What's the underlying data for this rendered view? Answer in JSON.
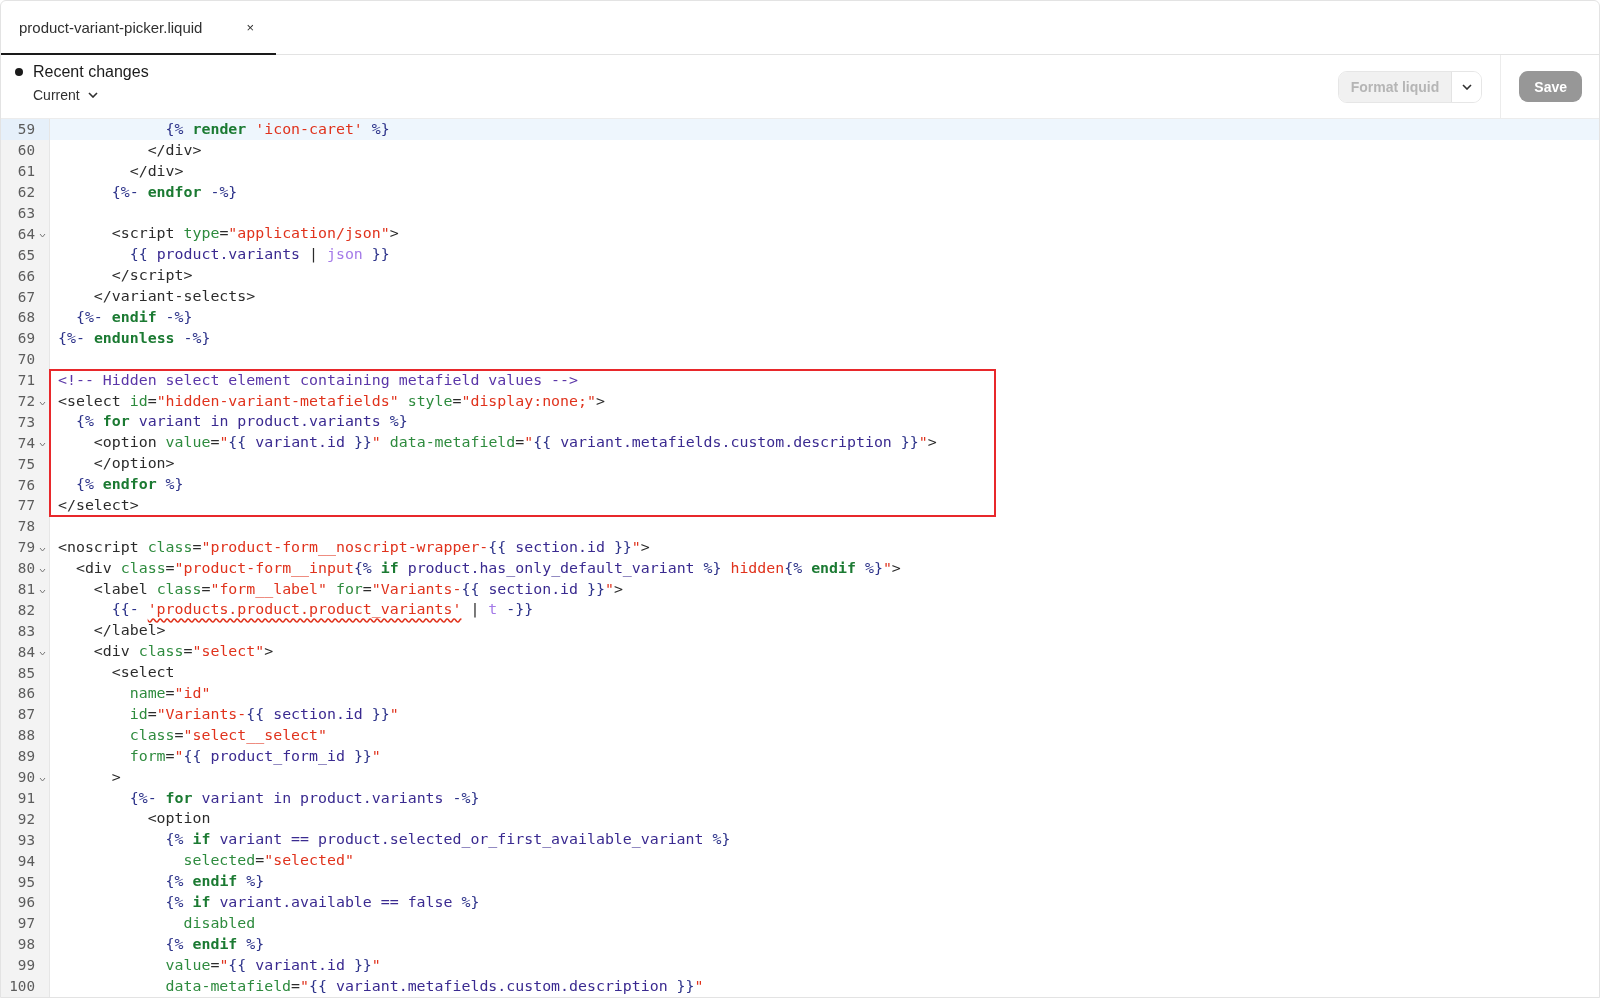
{
  "tab": {
    "title": "product-variant-picker.liquid",
    "close": "×",
    "selected": true
  },
  "toolbar": {
    "status": "Recent changes",
    "version": "Current",
    "format_button": {
      "label": "Format liquid",
      "disabled": true
    },
    "save_button": {
      "label": "Save",
      "disabled": true
    }
  },
  "code": {
    "segments": [
      {
        "highlighted": false,
        "lines": [
          {
            "number": "59",
            "fold": false,
            "active": true,
            "tokens": [
              {
                "kind": "delim",
                "text": "            {% "
              },
              {
                "kind": "keyword",
                "text": "render "
              },
              {
                "kind": "string",
                "text": "'icon-caret' "
              },
              {
                "kind": "delim",
                "text": "%}"
              }
            ]
          },
          {
            "number": "60",
            "fold": false,
            "active": false,
            "tokens": [
              {
                "kind": "tag",
                "text": "          </div>"
              }
            ]
          },
          {
            "number": "61",
            "fold": false,
            "active": false,
            "tokens": [
              {
                "kind": "tag",
                "text": "        </div>"
              }
            ]
          },
          {
            "number": "62",
            "fold": false,
            "active": false,
            "tokens": [
              {
                "kind": "delim",
                "text": "      {%- "
              },
              {
                "kind": "keyword",
                "text": "endfor "
              },
              {
                "kind": "delim",
                "text": "-%}"
              }
            ]
          },
          {
            "number": "63",
            "fold": false,
            "active": false
          },
          {
            "number": "64",
            "fold": true,
            "active": false,
            "tokens": [
              {
                "kind": "tag",
                "text": "      <script "
              },
              {
                "kind": "attr",
                "text": "type"
              },
              {
                "kind": "tag",
                "text": "="
              },
              {
                "kind": "string",
                "text": "\"application/json\""
              },
              {
                "kind": "tag",
                "text": ">"
              }
            ]
          },
          {
            "number": "65",
            "fold": false,
            "active": false,
            "tokens": [
              {
                "kind": "delim",
                "text": "        {{ "
              },
              {
                "kind": "var",
                "text": "product.variants "
              },
              {
                "kind": "tag",
                "text": "| "
              },
              {
                "kind": "filter",
                "text": "json "
              },
              {
                "kind": "delim",
                "text": "}}"
              }
            ]
          },
          {
            "number": "66",
            "fold": false,
            "active": false,
            "tokens": [
              {
                "kind": "tag",
                "text": "      </script>"
              }
            ]
          },
          {
            "number": "67",
            "fold": false,
            "active": false,
            "tokens": [
              {
                "kind": "tag",
                "text": "    </variant-selects>"
              }
            ]
          },
          {
            "number": "68",
            "fold": false,
            "active": false,
            "tokens": [
              {
                "kind": "delim",
                "text": "  {%- "
              },
              {
                "kind": "keyword",
                "text": "endif "
              },
              {
                "kind": "delim",
                "text": "-%}"
              }
            ]
          },
          {
            "number": "69",
            "fold": false,
            "active": false,
            "tokens": [
              {
                "kind": "delim",
                "text": "{%- "
              },
              {
                "kind": "keyword",
                "text": "endunless "
              },
              {
                "kind": "delim",
                "text": "-%}"
              }
            ]
          },
          {
            "number": "70",
            "fold": false,
            "active": false
          }
        ]
      },
      {
        "highlighted": true,
        "lines": [
          {
            "number": "71",
            "fold": false,
            "active": false,
            "tokens": [
              {
                "kind": "comment",
                "text": "<!-- Hidden select element containing metafield values -->"
              }
            ]
          },
          {
            "number": "72",
            "fold": true,
            "active": false,
            "tokens": [
              {
                "kind": "tag",
                "text": "<select "
              },
              {
                "kind": "attr",
                "text": "id"
              },
              {
                "kind": "tag",
                "text": "="
              },
              {
                "kind": "string",
                "text": "\"hidden-variant-metafields\" "
              },
              {
                "kind": "attr",
                "text": "style"
              },
              {
                "kind": "tag",
                "text": "="
              },
              {
                "kind": "string",
                "text": "\"display:none;\""
              },
              {
                "kind": "tag",
                "text": ">"
              }
            ]
          },
          {
            "number": "73",
            "fold": false,
            "active": false,
            "tokens": [
              {
                "kind": "delim",
                "text": "  {% "
              },
              {
                "kind": "keyword",
                "text": "for "
              },
              {
                "kind": "var",
                "text": "variant in product.variants "
              },
              {
                "kind": "delim",
                "text": "%}"
              }
            ]
          },
          {
            "number": "74",
            "fold": true,
            "active": false,
            "tokens": [
              {
                "kind": "tag",
                "text": "    <option "
              },
              {
                "kind": "attr",
                "text": "value"
              },
              {
                "kind": "tag",
                "text": "="
              },
              {
                "kind": "string",
                "text": "\""
              },
              {
                "kind": "delim",
                "text": "{{ "
              },
              {
                "kind": "var",
                "text": "variant.id "
              },
              {
                "kind": "delim",
                "text": "}}"
              },
              {
                "kind": "string",
                "text": "\" "
              },
              {
                "kind": "attr",
                "text": "data-metafield"
              },
              {
                "kind": "tag",
                "text": "="
              },
              {
                "kind": "string",
                "text": "\""
              },
              {
                "kind": "delim",
                "text": "{{ "
              },
              {
                "kind": "var",
                "text": "variant.metafields.custom.description "
              },
              {
                "kind": "delim",
                "text": "}}"
              },
              {
                "kind": "string",
                "text": "\""
              },
              {
                "kind": "tag",
                "text": ">"
              }
            ]
          },
          {
            "number": "75",
            "fold": false,
            "active": false,
            "tokens": [
              {
                "kind": "tag",
                "text": "    </option>"
              }
            ]
          },
          {
            "number": "76",
            "fold": false,
            "active": false,
            "tokens": [
              {
                "kind": "delim",
                "text": "  {% "
              },
              {
                "kind": "keyword",
                "text": "endfor "
              },
              {
                "kind": "delim",
                "text": "%}"
              }
            ]
          },
          {
            "number": "77",
            "fold": false,
            "active": false,
            "tokens": [
              {
                "kind": "tag",
                "text": "</select>"
              }
            ]
          }
        ]
      },
      {
        "highlighted": false,
        "lines": [
          {
            "number": "78",
            "fold": false,
            "active": false
          },
          {
            "number": "79",
            "fold": true,
            "active": false,
            "tokens": [
              {
                "kind": "tag",
                "text": "<noscript "
              },
              {
                "kind": "attr",
                "text": "class"
              },
              {
                "kind": "tag",
                "text": "="
              },
              {
                "kind": "string",
                "text": "\"product-form__noscript-wrapper-"
              },
              {
                "kind": "delim",
                "text": "{{ "
              },
              {
                "kind": "var",
                "text": "section.id "
              },
              {
                "kind": "delim",
                "text": "}}"
              },
              {
                "kind": "string",
                "text": "\""
              },
              {
                "kind": "tag",
                "text": ">"
              }
            ]
          },
          {
            "number": "80",
            "fold": true,
            "active": false,
            "tokens": [
              {
                "kind": "tag",
                "text": "  <div "
              },
              {
                "kind": "attr",
                "text": "class"
              },
              {
                "kind": "tag",
                "text": "="
              },
              {
                "kind": "string",
                "text": "\"product-form__input"
              },
              {
                "kind": "delim",
                "text": "{% "
              },
              {
                "kind": "keyword",
                "text": "if "
              },
              {
                "kind": "var",
                "text": "product.has_only_default_variant "
              },
              {
                "kind": "delim",
                "text": "%}"
              },
              {
                "kind": "string",
                "text": " hidden"
              },
              {
                "kind": "delim",
                "text": "{% "
              },
              {
                "kind": "keyword",
                "text": "endif "
              },
              {
                "kind": "delim",
                "text": "%}"
              },
              {
                "kind": "string",
                "text": "\""
              },
              {
                "kind": "tag",
                "text": ">"
              }
            ]
          },
          {
            "number": "81",
            "fold": true,
            "active": false,
            "tokens": [
              {
                "kind": "tag",
                "text": "    <label "
              },
              {
                "kind": "attr",
                "text": "class"
              },
              {
                "kind": "tag",
                "text": "="
              },
              {
                "kind": "string",
                "text": "\"form__label\" "
              },
              {
                "kind": "attr",
                "text": "for"
              },
              {
                "kind": "tag",
                "text": "="
              },
              {
                "kind": "string",
                "text": "\"Variants-"
              },
              {
                "kind": "delim",
                "text": "{{ "
              },
              {
                "kind": "var",
                "text": "section.id "
              },
              {
                "kind": "delim",
                "text": "}}"
              },
              {
                "kind": "string",
                "text": "\""
              },
              {
                "kind": "tag",
                "text": ">"
              }
            ]
          },
          {
            "number": "82",
            "fold": false,
            "active": false,
            "tokens": [
              {
                "kind": "delim",
                "text": "      {{- "
              },
              {
                "kind": "flagged",
                "text": "'products.product.product_variants'"
              },
              {
                "kind": "tag",
                "text": " | "
              },
              {
                "kind": "filter",
                "text": "t "
              },
              {
                "kind": "delim",
                "text": "-}}"
              }
            ]
          },
          {
            "number": "83",
            "fold": false,
            "active": false,
            "tokens": [
              {
                "kind": "tag",
                "text": "    </label>"
              }
            ]
          },
          {
            "number": "84",
            "fold": true,
            "active": false,
            "tokens": [
              {
                "kind": "tag",
                "text": "    <div "
              },
              {
                "kind": "attr",
                "text": "class"
              },
              {
                "kind": "tag",
                "text": "="
              },
              {
                "kind": "string",
                "text": "\"select\""
              },
              {
                "kind": "tag",
                "text": ">"
              }
            ]
          },
          {
            "number": "85",
            "fold": false,
            "active": false,
            "tokens": [
              {
                "kind": "tag",
                "text": "      <select"
              }
            ]
          },
          {
            "number": "86",
            "fold": false,
            "active": false,
            "tokens": [
              {
                "kind": "attr",
                "text": "        name"
              },
              {
                "kind": "tag",
                "text": "="
              },
              {
                "kind": "string",
                "text": "\"id\""
              }
            ]
          },
          {
            "number": "87",
            "fold": false,
            "active": false,
            "tokens": [
              {
                "kind": "attr",
                "text": "        id"
              },
              {
                "kind": "tag",
                "text": "="
              },
              {
                "kind": "string",
                "text": "\"Variants-"
              },
              {
                "kind": "delim",
                "text": "{{ "
              },
              {
                "kind": "var",
                "text": "section.id "
              },
              {
                "kind": "delim",
                "text": "}}"
              },
              {
                "kind": "string",
                "text": "\""
              }
            ]
          },
          {
            "number": "88",
            "fold": false,
            "active": false,
            "tokens": [
              {
                "kind": "attr",
                "text": "        class"
              },
              {
                "kind": "tag",
                "text": "="
              },
              {
                "kind": "string",
                "text": "\"select__select\""
              }
            ]
          },
          {
            "number": "89",
            "fold": false,
            "active": false,
            "tokens": [
              {
                "kind": "attr",
                "text": "        form"
              },
              {
                "kind": "tag",
                "text": "="
              },
              {
                "kind": "string",
                "text": "\""
              },
              {
                "kind": "delim",
                "text": "{{ "
              },
              {
                "kind": "var",
                "text": "product_form_id "
              },
              {
                "kind": "delim",
                "text": "}}"
              },
              {
                "kind": "string",
                "text": "\""
              }
            ]
          },
          {
            "number": "90",
            "fold": true,
            "active": false,
            "tokens": [
              {
                "kind": "tag",
                "text": "      >"
              }
            ]
          },
          {
            "number": "91",
            "fold": false,
            "active": false,
            "tokens": [
              {
                "kind": "delim",
                "text": "        {%- "
              },
              {
                "kind": "keyword",
                "text": "for "
              },
              {
                "kind": "var",
                "text": "variant in product.variants "
              },
              {
                "kind": "delim",
                "text": "-%}"
              }
            ]
          },
          {
            "number": "92",
            "fold": false,
            "active": false,
            "tokens": [
              {
                "kind": "tag",
                "text": "          <option"
              }
            ]
          },
          {
            "number": "93",
            "fold": false,
            "active": false,
            "tokens": [
              {
                "kind": "delim",
                "text": "            {% "
              },
              {
                "kind": "keyword",
                "text": "if "
              },
              {
                "kind": "var",
                "text": "variant == product.selected_or_first_available_variant "
              },
              {
                "kind": "delim",
                "text": "%}"
              }
            ]
          },
          {
            "number": "94",
            "fold": false,
            "active": false,
            "tokens": [
              {
                "kind": "attr",
                "text": "              selected"
              },
              {
                "kind": "tag",
                "text": "="
              },
              {
                "kind": "string",
                "text": "\"selected\""
              }
            ]
          },
          {
            "number": "95",
            "fold": false,
            "active": false,
            "tokens": [
              {
                "kind": "delim",
                "text": "            {% "
              },
              {
                "kind": "keyword",
                "text": "endif "
              },
              {
                "kind": "delim",
                "text": "%}"
              }
            ]
          },
          {
            "number": "96",
            "fold": false,
            "active": false,
            "tokens": [
              {
                "kind": "delim",
                "text": "            {% "
              },
              {
                "kind": "keyword",
                "text": "if "
              },
              {
                "kind": "var",
                "text": "variant.available == false "
              },
              {
                "kind": "delim",
                "text": "%}"
              }
            ]
          },
          {
            "number": "97",
            "fold": false,
            "active": false,
            "tokens": [
              {
                "kind": "attr",
                "text": "              disabled"
              }
            ]
          },
          {
            "number": "98",
            "fold": false,
            "active": false,
            "tokens": [
              {
                "kind": "delim",
                "text": "            {% "
              },
              {
                "kind": "keyword",
                "text": "endif "
              },
              {
                "kind": "delim",
                "text": "%}"
              }
            ]
          },
          {
            "number": "99",
            "fold": false,
            "active": false,
            "tokens": [
              {
                "kind": "attr",
                "text": "            value"
              },
              {
                "kind": "tag",
                "text": "="
              },
              {
                "kind": "string",
                "text": "\""
              },
              {
                "kind": "delim",
                "text": "{{ "
              },
              {
                "kind": "var",
                "text": "variant.id "
              },
              {
                "kind": "delim",
                "text": "}}"
              },
              {
                "kind": "string",
                "text": "\""
              }
            ]
          },
          {
            "number": "100",
            "fold": false,
            "active": false,
            "tokens": [
              {
                "kind": "attr",
                "text": "            data-metafield"
              },
              {
                "kind": "tag",
                "text": "="
              },
              {
                "kind": "string",
                "text": "\""
              },
              {
                "kind": "delim",
                "text": "{{ "
              },
              {
                "kind": "var",
                "text": "variant.metafields.custom.description "
              },
              {
                "kind": "delim",
                "text": "}}"
              },
              {
                "kind": "string",
                "text": "\""
              }
            ]
          }
        ]
      }
    ]
  }
}
